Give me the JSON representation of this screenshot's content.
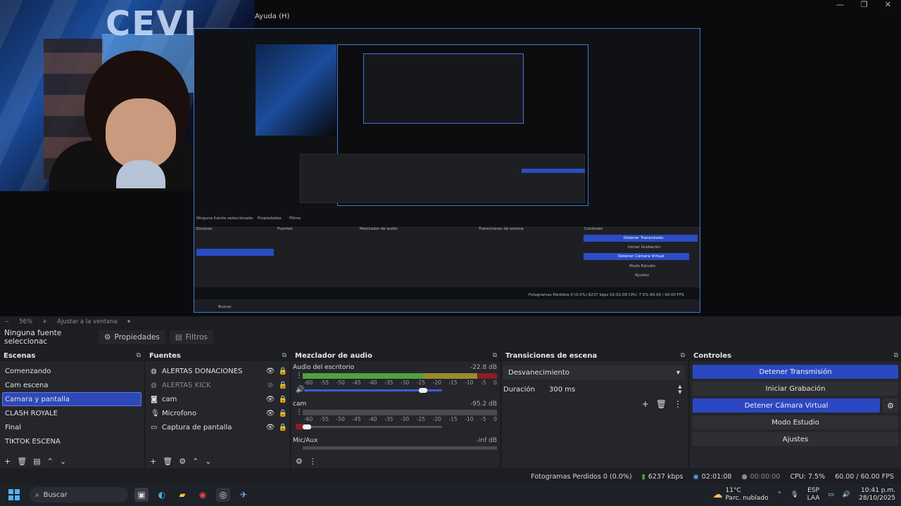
{
  "preview": {
    "menu_label": "Ayuda (H)",
    "window_controls": [
      "—",
      "❐",
      "✕"
    ],
    "nested_texts": {
      "no_source": "Ninguna fuente seleccionada",
      "props": "Propiedades",
      "filters": "Filtros",
      "scenes": "Escenas",
      "sources": "Fuentes",
      "mixer": "Mezclador de audio",
      "transitions": "Transiciones de escena",
      "controls": "Controles",
      "stop_stream": "Detener Transmisión",
      "start_rec": "Iniciar Grabación",
      "stop_vcam": "Detener Cámara Virtual",
      "studio": "Modo Estudio",
      "settings": "Ajustes",
      "status": "Fotogramas Perdidos 0 (0.0%)   6237 kbps   02:01:08   CPU: 7.5%   60.00 / 60.00 FPS",
      "search": "Buscar",
      "zoom": "56%   Ajustar a la ventana"
    }
  },
  "zoom_bar": {
    "minus": "−",
    "zoom": "56%",
    "plus": "+",
    "fit": "Ajustar a la ventana",
    "caret": "▾"
  },
  "source_toolbar": {
    "no_source": "Ninguna fuente seleccionac",
    "properties": "Propiedades",
    "filters": "Filtros"
  },
  "scenes": {
    "title": "Escenas",
    "items": [
      "Comenzando",
      "Cam escena",
      "Camara y pantalla",
      "CLASH ROYALE",
      "Final",
      "TIKTOK ESCENA"
    ],
    "selected_index": 2
  },
  "sources": {
    "title": "Fuentes",
    "items": [
      {
        "label": "ALERTAS DONACIONES",
        "icon": "globe-icon",
        "visible": true
      },
      {
        "label": "ALERTAS KICK",
        "icon": "globe-icon",
        "visible": false
      },
      {
        "label": "cam",
        "icon": "camera-icon",
        "visible": true
      },
      {
        "label": "Microfono",
        "icon": "microphone-icon",
        "visible": true
      },
      {
        "label": "Captura de pantalla",
        "icon": "monitor-icon",
        "visible": true
      }
    ]
  },
  "mixer": {
    "title": "Mezclador de audio",
    "ticks": [
      "-60",
      "-55",
      "-50",
      "-45",
      "-40",
      "-35",
      "-30",
      "-25",
      "-20",
      "-15",
      "-10",
      "-5",
      "0"
    ],
    "channels": [
      {
        "name": "Audio del escritorio",
        "db": "-22.8 dB",
        "level": 0.62,
        "volume": 0.86
      },
      {
        "name": "cam",
        "db": "-95.2 dB",
        "level": 0.0,
        "volume": 0.02
      },
      {
        "name": "Mic/Aux",
        "db": "-inf dB",
        "level": 0.0,
        "volume": 0.0
      }
    ]
  },
  "transitions": {
    "title": "Transiciones de escena",
    "type": "Desvanecimiento",
    "duration_label": "Duración",
    "duration_value": "300 ms"
  },
  "controls": {
    "title": "Controles",
    "buttons": [
      "Detener Transmisión",
      "Iniciar Grabación",
      "Detener Cámara Virtual",
      "Modo Estudio",
      "Ajustes"
    ]
  },
  "status_bar": {
    "dropped": "Fotogramas Perdidos 0 (0.0%)",
    "bitrate": "6237 kbps",
    "stream_time": "02:01:08",
    "rec_time": "00:00:00",
    "cpu": "CPU: 7.5%",
    "fps": "60.00 / 60.00 FPS"
  },
  "taskbar": {
    "search": "Buscar",
    "weather_temp": "11°C",
    "weather_desc": "Parc. nublado",
    "lang1": "ESP",
    "lang2": "LAA",
    "time": "10:41 p.m.",
    "date": "28/10/2025"
  },
  "colors": {
    "accent": "#2b48c2",
    "selected": "#2f48b7",
    "meter_green": "#4ca33b",
    "meter_red": "#8b1d26",
    "panel": "#25262b",
    "bg": "#1d1e22"
  }
}
